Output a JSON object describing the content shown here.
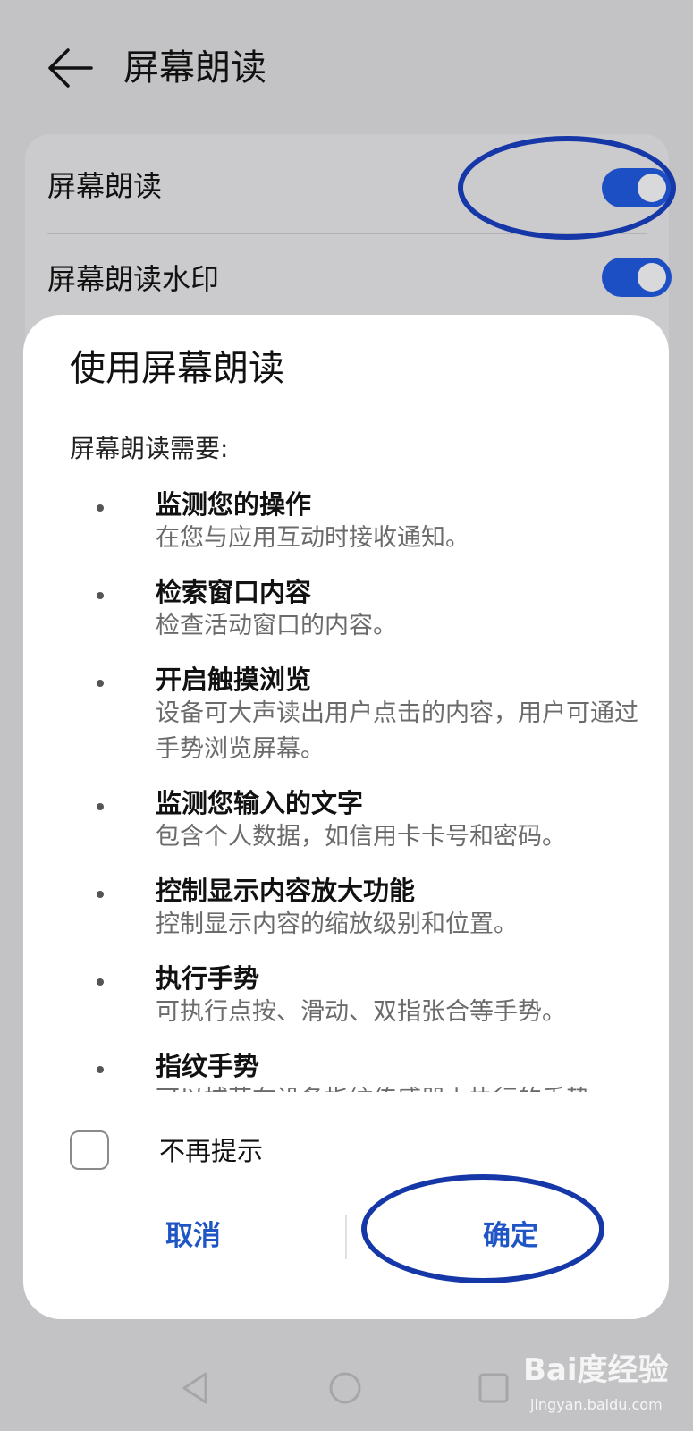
{
  "header": {
    "title": "屏幕朗读"
  },
  "settings": {
    "rows": [
      {
        "label": "屏幕朗读",
        "enabled": true
      },
      {
        "label": "屏幕朗读水印",
        "enabled": true
      }
    ]
  },
  "dialog": {
    "title": "使用屏幕朗读",
    "subtitle": "屏幕朗读需要:",
    "permissions": [
      {
        "name": "监测您的操作",
        "description": "在您与应用互动时接收通知。"
      },
      {
        "name": "检索窗口内容",
        "description": "检查活动窗口的内容。"
      },
      {
        "name": "开启触摸浏览",
        "description": "设备可大声读出用户点击的内容，用户可通过手势浏览屏幕。"
      },
      {
        "name": "监测您输入的文字",
        "description": "包含个人数据，如信用卡卡号和密码。"
      },
      {
        "name": "控制显示内容放大功能",
        "description": "控制显示内容的缩放级别和位置。"
      },
      {
        "name": "执行手势",
        "description": "可执行点按、滑动、双指张合等手势。"
      },
      {
        "name": "指纹手势",
        "description": "可以捕获在设备指纹传感器上执行的手势。"
      }
    ],
    "dont_remind": {
      "label": "不再提示",
      "checked": false
    },
    "cancel_label": "取消",
    "confirm_label": "确定"
  },
  "watermark": {
    "brand": "Bai度经验",
    "url": "jingyan.baidu.com"
  },
  "colors": {
    "accent": "#1f55c5",
    "toggle_on": "#1d4fc4",
    "annotation": "#1537a8",
    "scrim_background": "#c3c3c5"
  },
  "icons": {
    "back": "arrow-left-icon",
    "nav_back": "triangle-back-icon",
    "nav_home": "circle-home-icon",
    "nav_recent": "square-recent-icon"
  }
}
